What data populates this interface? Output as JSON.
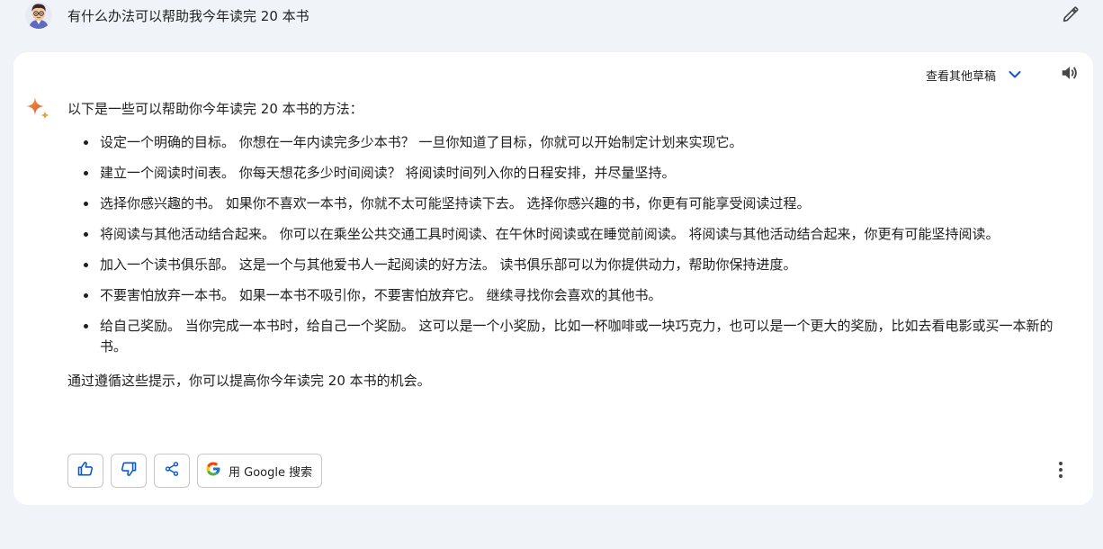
{
  "prompt": {
    "text": "有什么办法可以帮助我今年读完 20 本书"
  },
  "response": {
    "drafts_label": "查看其他草稿",
    "intro": "以下是一些可以帮助你今年读完 20 本书的方法：",
    "tips": [
      "设定一个明确的目标。 你想在一年内读完多少本书？ 一旦你知道了目标，你就可以开始制定计划来实现它。",
      "建立一个阅读时间表。 你每天想花多少时间阅读？ 将阅读时间列入你的日程安排，并尽量坚持。",
      "选择你感兴趣的书。 如果你不喜欢一本书，你就不太可能坚持读下去。 选择你感兴趣的书，你更有可能享受阅读过程。",
      "将阅读与其他活动结合起来。 你可以在乘坐公共交通工具时阅读、在午休时阅读或在睡觉前阅读。 将阅读与其他活动结合起来，你更有可能坚持阅读。",
      "加入一个读书俱乐部。 这是一个与其他爱书人一起阅读的好方法。 读书俱乐部可以为你提供动力，帮助你保持进度。",
      "不要害怕放弃一本书。 如果一本书不吸引你，不要害怕放弃它。 继续寻找你会喜欢的其他书。",
      "给自己奖励。 当你完成一本书时，给自己一个奖励。 这可以是一个小奖励，比如一杯咖啡或一块巧克力，也可以是一个更大的奖励，比如去看电影或买一本新的书。"
    ],
    "outro": "通过遵循这些提示，你可以提高你今年读完 20 本书的机会。"
  },
  "actions": {
    "google_search_label": "用 Google 搜索"
  },
  "icons": {
    "avatar": "user-avatar",
    "edit": "pencil-icon",
    "chevron": "chevron-down-icon",
    "speaker": "speaker-icon",
    "sparkle": "sparkle-icon",
    "thumbs_up": "thumbs-up-icon",
    "thumbs_down": "thumbs-down-icon",
    "share": "share-icon",
    "google": "google-g-icon",
    "more": "more-vert-icon"
  },
  "colors": {
    "page_background": "#f0f4f9",
    "card_background": "#ffffff",
    "accent_blue": "#0b57d0",
    "text": "#1f1f1f"
  }
}
